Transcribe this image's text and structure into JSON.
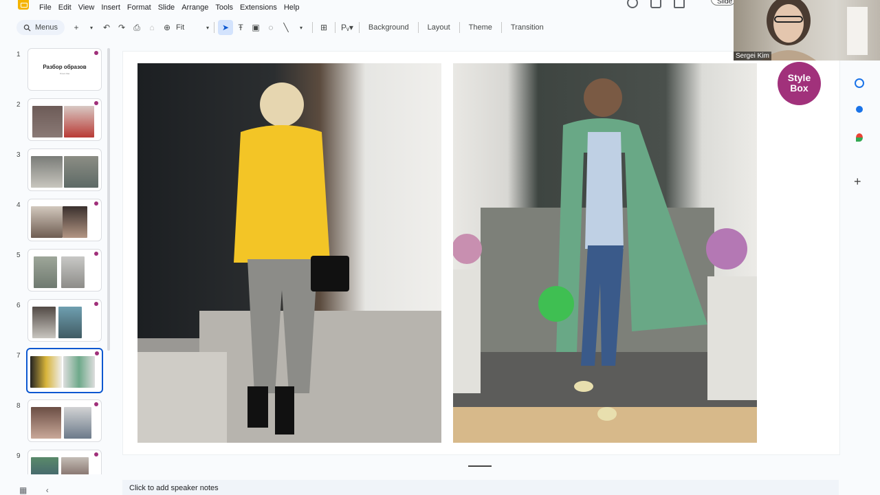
{
  "menu": {
    "items": [
      "File",
      "Edit",
      "View",
      "Insert",
      "Format",
      "Slide",
      "Arrange",
      "Tools",
      "Extensions",
      "Help"
    ],
    "slideshow_label": "Slide"
  },
  "toolbar": {
    "search_label": "Menus",
    "zoom_value": "Fit",
    "background_label": "Background",
    "layout_label": "Layout",
    "theme_label": "Theme",
    "transition_label": "Transition"
  },
  "filmstrip": {
    "slides": [
      {
        "number": "1",
        "title": "Разбор образов",
        "subtitle": "Ольга Каа"
      },
      {
        "number": "2"
      },
      {
        "number": "3"
      },
      {
        "number": "4"
      },
      {
        "number": "5"
      },
      {
        "number": "6"
      },
      {
        "number": "7",
        "selected": true
      },
      {
        "number": "8"
      },
      {
        "number": "9"
      }
    ]
  },
  "slide": {
    "badge_line1": "Style",
    "badge_line2": "Box",
    "badge_color": "#a1317b"
  },
  "webcam": {
    "participant_name": "Sergei Kim"
  },
  "notes": {
    "placeholder": "Click to add speaker notes"
  },
  "colors": {
    "accent": "#0b57d0",
    "app_logo": "#f4b400"
  }
}
